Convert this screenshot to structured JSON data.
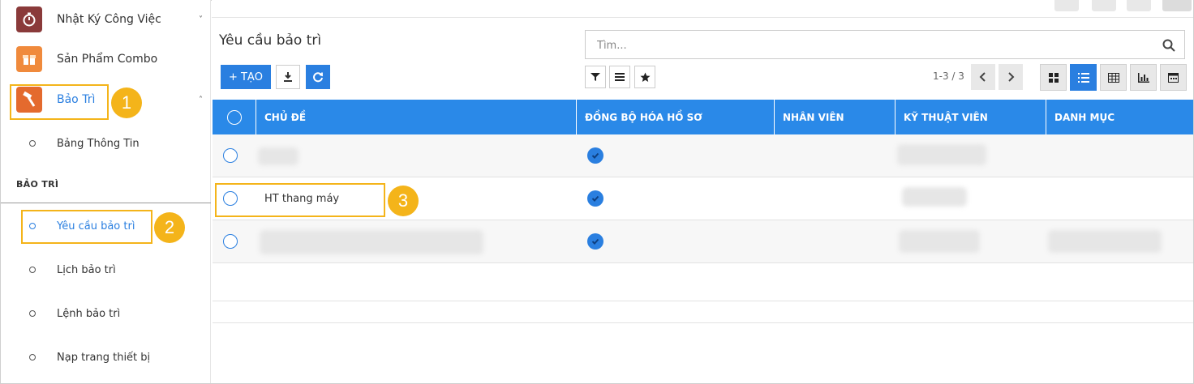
{
  "sidebar": {
    "apps": [
      {
        "label": "Nhật Ký Công Việc",
        "icon": "stopwatch-icon",
        "color": "#8a3a3a",
        "chevron": "˅"
      },
      {
        "label": "Sản Phẩm Combo",
        "icon": "gift-box-icon",
        "color": "#f08a3c"
      },
      {
        "label": "Bảo Trì",
        "icon": "hammer-icon",
        "color": "#e46a2e",
        "chevron": "˄"
      }
    ],
    "sub_top": {
      "label": "Bảng Thông Tin"
    },
    "section_title": "BẢO TRÌ",
    "items": [
      {
        "label": "Yêu cầu bảo trì",
        "active": true
      },
      {
        "label": "Lịch bảo trì"
      },
      {
        "label": "Lệnh bảo trì"
      },
      {
        "label": "Nạp trang thiết bị"
      }
    ]
  },
  "annotations": [
    "1",
    "2",
    "3"
  ],
  "header": {
    "title": "Yêu cầu bảo trì",
    "search_placeholder": "Tìm...",
    "create_label": "+ TẠO",
    "pager": "1-3 / 3"
  },
  "colors": {
    "accent": "#2a7fe0",
    "highlight": "#f4b41a"
  },
  "table": {
    "columns": [
      "CHỦ ĐỀ",
      "ĐỒNG BỘ HÓA HỒ SƠ",
      "NHÂN VIÊN",
      "KỸ THUẬT VIÊN",
      "DANH MỤC"
    ],
    "rows": [
      {
        "subject": "",
        "synced": true
      },
      {
        "subject": "HT thang máy",
        "synced": true
      },
      {
        "subject": "",
        "synced": true
      }
    ]
  }
}
